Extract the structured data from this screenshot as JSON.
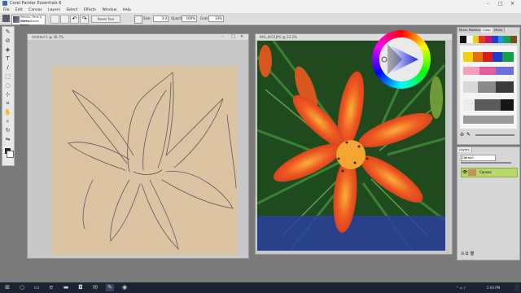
{
  "app": {
    "title": "Corel Painter Essentials 6"
  },
  "menu": [
    "File",
    "Edit",
    "Canvas",
    "Layers",
    "Select",
    "Effects",
    "Window",
    "Help"
  ],
  "toolbar": {
    "brush_category": "Pencils: Pens & Markers",
    "brush_variant": "Grainy Cover Pencil",
    "reset_label": "Reset Tool",
    "size_label": "Size:",
    "size_value": "3.0",
    "opacity_label": "Opacity:",
    "opacity_value": "100%",
    "grain_label": "Grain:",
    "grain_value": "33%"
  },
  "documents": [
    {
      "title": "Untitled-1 @ 36.7%"
    },
    {
      "title": "IMG_0011JPG @ 33.2%"
    }
  ],
  "panels": {
    "tabs": [
      "Mixer Palettes",
      "Color",
      "Mixer"
    ],
    "layers_title": "Layers",
    "blend_label": "Default",
    "layer_name": "Canvas"
  },
  "colors": {
    "canvas": "#dbc4a2",
    "petal": "#e0401e",
    "leaf": "#2e6a2a",
    "layer_highlight": "#b6d86a",
    "taskbar": "#1d2330"
  },
  "taskbar": {
    "clock": "5:04 PM"
  }
}
